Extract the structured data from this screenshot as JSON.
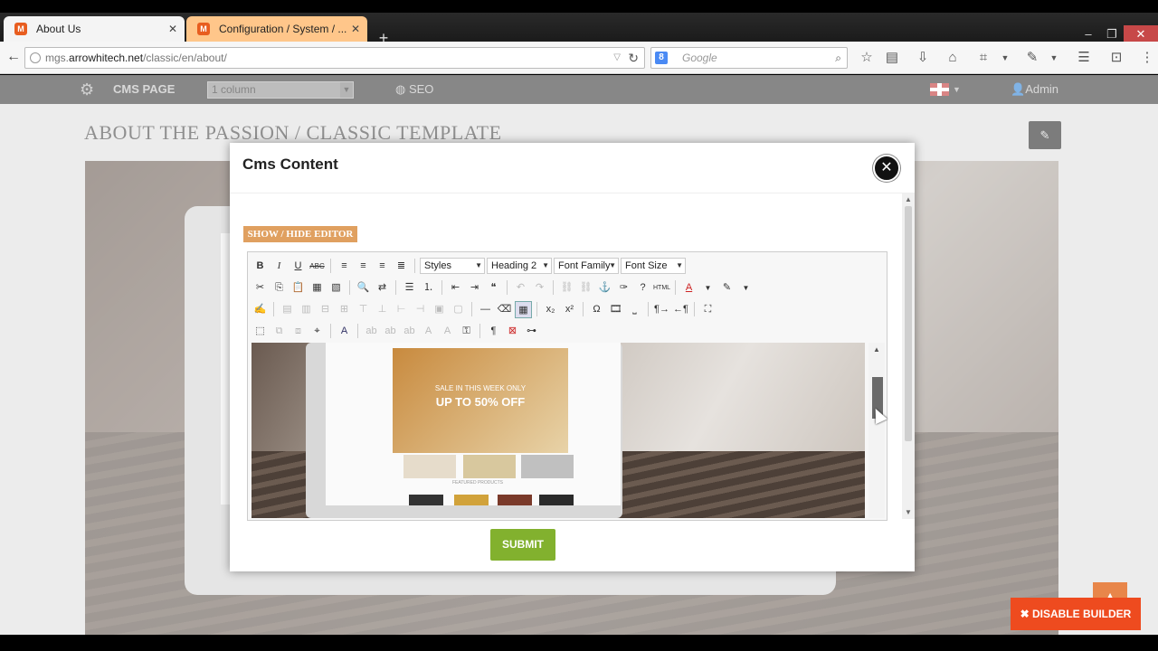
{
  "browser": {
    "tabs": [
      {
        "label": "About Us",
        "close": "✕"
      },
      {
        "label": "Configuration / System / ...",
        "close": "✕"
      }
    ],
    "new_tab": "+",
    "url_prefix": "mgs.",
    "url_domain": "arrowhitech.net",
    "url_path": "/classic/en/about/",
    "search_placeholder": "Google",
    "search_engine_letter": "8"
  },
  "adminbar": {
    "cms_page_label": "CMS PAGE",
    "layout_select_value": "1 column",
    "seo_label": "SEO",
    "admin_label": "Admin"
  },
  "page": {
    "title": "ABOUT THE PASSION / CLASSIC TEMPLATE",
    "disable_builder_label": "DISABLE BUILDER"
  },
  "modal": {
    "title": "Cms Content",
    "show_hide_label": "SHOW / HIDE EDITOR",
    "submit_label": "SUBMIT",
    "toolbar": {
      "styles": "Styles",
      "heading": "Heading 2",
      "font_family": "Font Family",
      "font_size": "Font Size"
    },
    "preview": {
      "sale_small": "SALE IN THIS WEEK ONLY",
      "sale_big": "UP TO 50% OFF",
      "caption": "FEATURED PRODUCTS"
    }
  },
  "colors": {
    "accent_submit": "#82b12e",
    "accent_disable": "#ee4b1f",
    "show_hide_bg": "#e0a060",
    "adminbar_bg": "#262626"
  }
}
